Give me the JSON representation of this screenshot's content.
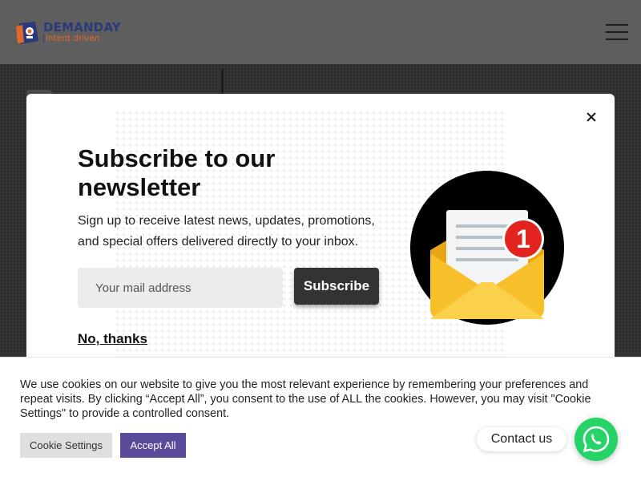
{
  "header": {
    "logo_name": "DEMANDAY",
    "logo_tagline": "intent driven"
  },
  "newsletter": {
    "title": "Subscribe to our newsletter",
    "description": "Sign up to receive latest news, updates, promotions, and special offers delivered directly to your inbox.",
    "email_placeholder": "Your mail address",
    "subscribe_label": "Subscribe",
    "decline_label": "No, thanks",
    "notification_count": "1"
  },
  "cookie": {
    "text": "We use cookies on our website to give you the most relevant experience by remembering your preferences and repeat visits. By clicking “Accept All”, you consent to the use of ALL the cookies. However, you may visit \"Cookie Settings\" to provide a controlled consent.",
    "settings_label": "Cookie Settings",
    "accept_label": "Accept All"
  },
  "contact": {
    "label": "Contact us"
  },
  "colors": {
    "accent": "#5a4a99",
    "whatsapp": "#25d366",
    "envelope": "#f5b41c",
    "badge": "#e3231d"
  },
  "icons": [
    "logo-icon",
    "hamburger-menu-icon",
    "close-icon",
    "mail-notification-icon",
    "whatsapp-icon"
  ]
}
